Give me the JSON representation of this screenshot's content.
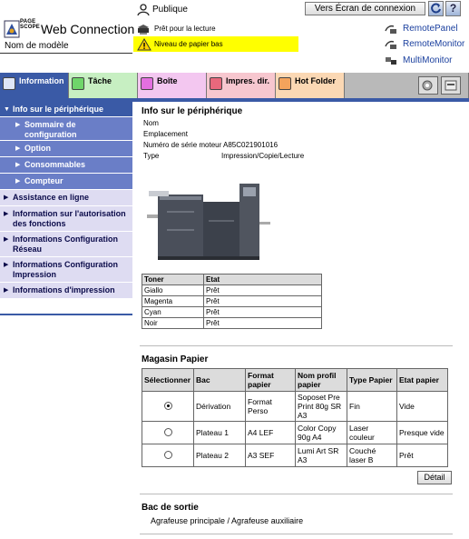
{
  "header": {
    "logo_brand": "PAGE SCOPE",
    "title": "Web Connection",
    "model_label": "Nom de modèle",
    "user": "Publique",
    "login_button": "Vers Écran de connexion",
    "help_button": "?",
    "status_ready": "Prêt pour la lecture",
    "status_warning": "Niveau de papier bas",
    "links": [
      "RemotePanel",
      "RemoteMonitor",
      "MultiMonitor"
    ]
  },
  "tabs": [
    "Information",
    "Tâche",
    "Boîte",
    "Impres. dir.",
    "Hot Folder"
  ],
  "sidebar": {
    "items": [
      {
        "label": "Info sur le périphérique",
        "type": "active"
      },
      {
        "label": "Sommaire de configuration",
        "type": "sub"
      },
      {
        "label": "Option",
        "type": "sub"
      },
      {
        "label": "Consommables",
        "type": "sub"
      },
      {
        "label": "Compteur",
        "type": "sub"
      },
      {
        "label": "Assistance en ligne",
        "type": "norm"
      },
      {
        "label": "Information sur l'autorisation des fonctions",
        "type": "norm"
      },
      {
        "label": "Informations Configuration Réseau",
        "type": "norm"
      },
      {
        "label": "Informations Configuration Impression",
        "type": "norm"
      },
      {
        "label": "Informations d'impression",
        "type": "norm"
      }
    ]
  },
  "device": {
    "heading": "Info sur le périphérique",
    "rows": [
      {
        "label": "Nom",
        "value": ""
      },
      {
        "label": "Emplacement",
        "value": ""
      },
      {
        "label": "Numéro de série moteur",
        "value": "A85C021901016"
      },
      {
        "label": "Type",
        "value": "Impression/Copie/Lecture"
      }
    ]
  },
  "toner": {
    "headers": [
      "Toner",
      "Etat"
    ],
    "rows": [
      [
        "Giallo",
        "Prêt"
      ],
      [
        "Magenta",
        "Prêt"
      ],
      [
        "Cyan",
        "Prêt"
      ],
      [
        "Noir",
        "Prêt"
      ]
    ]
  },
  "magasin": {
    "heading": "Magasin Papier",
    "headers": [
      "Sélectionner",
      "Bac",
      "Format papier",
      "Nom profil papier",
      "Type Papier",
      "Etat papier"
    ],
    "rows": [
      {
        "selected": true,
        "bac": "Dérivation",
        "format": "Format Perso",
        "profil": "Soposet Pre Print 80g SR A3",
        "type": "Fin",
        "etat": "Vide"
      },
      {
        "selected": false,
        "bac": "Plateau 1",
        "format": "A4 LEF",
        "profil": "Color Copy 90g A4",
        "type": "Laser couleur",
        "etat": "Presque vide"
      },
      {
        "selected": false,
        "bac": "Plateau 2",
        "format": "A3 SEF",
        "profil": "Lumi Art SR A3",
        "type": "Couché laser B",
        "etat": "Prêt"
      }
    ],
    "detail_button": "Détail"
  },
  "sortie": {
    "heading": "Bac de sortie",
    "text": "Agrafeuse principale / Agrafeuse auxiliaire"
  },
  "colors": {
    "accent": "#3a5aa6",
    "warning": "#ffff00",
    "link": "#1a3f9e"
  }
}
